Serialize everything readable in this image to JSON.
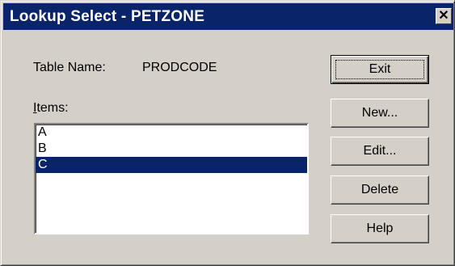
{
  "window": {
    "title": "Lookup Select - PETZONE",
    "close_glyph": "✕"
  },
  "table": {
    "label": "Table Name:",
    "value": "PRODCODE"
  },
  "items": {
    "label": "Items:",
    "list": [
      "A",
      "B",
      "C"
    ],
    "selected_index": 2
  },
  "buttons": {
    "exit": "Exit",
    "new": "New...",
    "edit": "Edit...",
    "delete": "Delete",
    "help": "Help"
  },
  "colors": {
    "titlebar": "#0a246a",
    "face": "#d4d0c8",
    "selection": "#0a246a"
  }
}
